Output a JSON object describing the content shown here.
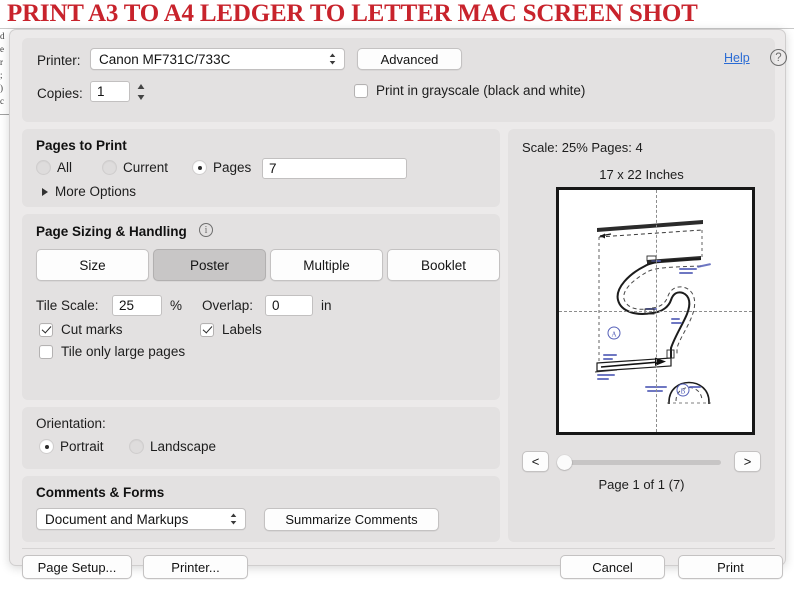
{
  "title": "PRINT A3 TO A4 LEDGER TO LETTER MAC SCREEN SHOT",
  "title_color": "#c8232c",
  "printer_section": {
    "printer_label": "Printer:",
    "printer_value": "Canon MF731C/733C",
    "advanced_label": "Advanced",
    "help_label": "Help",
    "help_icon": "question-mark-icon",
    "copies_label": "Copies:",
    "copies_value": "1",
    "grayscale_label": "Print in grayscale (black and white)",
    "grayscale_checked": false
  },
  "pages_to_print": {
    "title": "Pages to Print",
    "options": [
      {
        "label": "All",
        "selected": false
      },
      {
        "label": "Current",
        "selected": false
      },
      {
        "label": "Pages",
        "selected": true
      }
    ],
    "pages_value": "7",
    "more_options_label": "More Options"
  },
  "page_sizing": {
    "title": "Page Sizing & Handling",
    "info_icon": "info-icon",
    "modes": [
      {
        "label": "Size",
        "active": false
      },
      {
        "label": "Poster",
        "active": true
      },
      {
        "label": "Multiple",
        "active": false
      },
      {
        "label": "Booklet",
        "active": false
      }
    ],
    "tile_scale_label": "Tile Scale:",
    "tile_scale_value": "25",
    "percent_unit": "%",
    "overlap_label": "Overlap:",
    "overlap_value": "0",
    "inch_unit": "in",
    "checkboxes": [
      {
        "label": "Cut marks",
        "checked": true
      },
      {
        "label": "Labels",
        "checked": true
      },
      {
        "label": "Tile only large pages",
        "checked": false
      }
    ]
  },
  "orientation": {
    "title": "Orientation:",
    "options": [
      {
        "label": "Portrait",
        "selected": true
      },
      {
        "label": "Landscape",
        "selected": false
      }
    ]
  },
  "comments_forms": {
    "title": "Comments & Forms",
    "select_value": "Document and Markups",
    "summarize_label": "Summarize Comments"
  },
  "preview": {
    "scale_line": "Scale:  25% Pages: 4",
    "size_line": "17 x 22 Inches",
    "prev_label": "<",
    "next_label": ">",
    "page_of": "Page 1 of 1 (7)",
    "content_description": "technical sewing pattern line drawing with dashed seam allowances, fold lines and blue handwritten annotations"
  },
  "footer": {
    "page_setup_label": "Page Setup...",
    "printer_label": "Printer...",
    "cancel_label": "Cancel",
    "print_label": "Print"
  },
  "background": {
    "edge_text": "d\ne\nr\n;\n)\nc\n—\n\n\n\n\n"
  }
}
